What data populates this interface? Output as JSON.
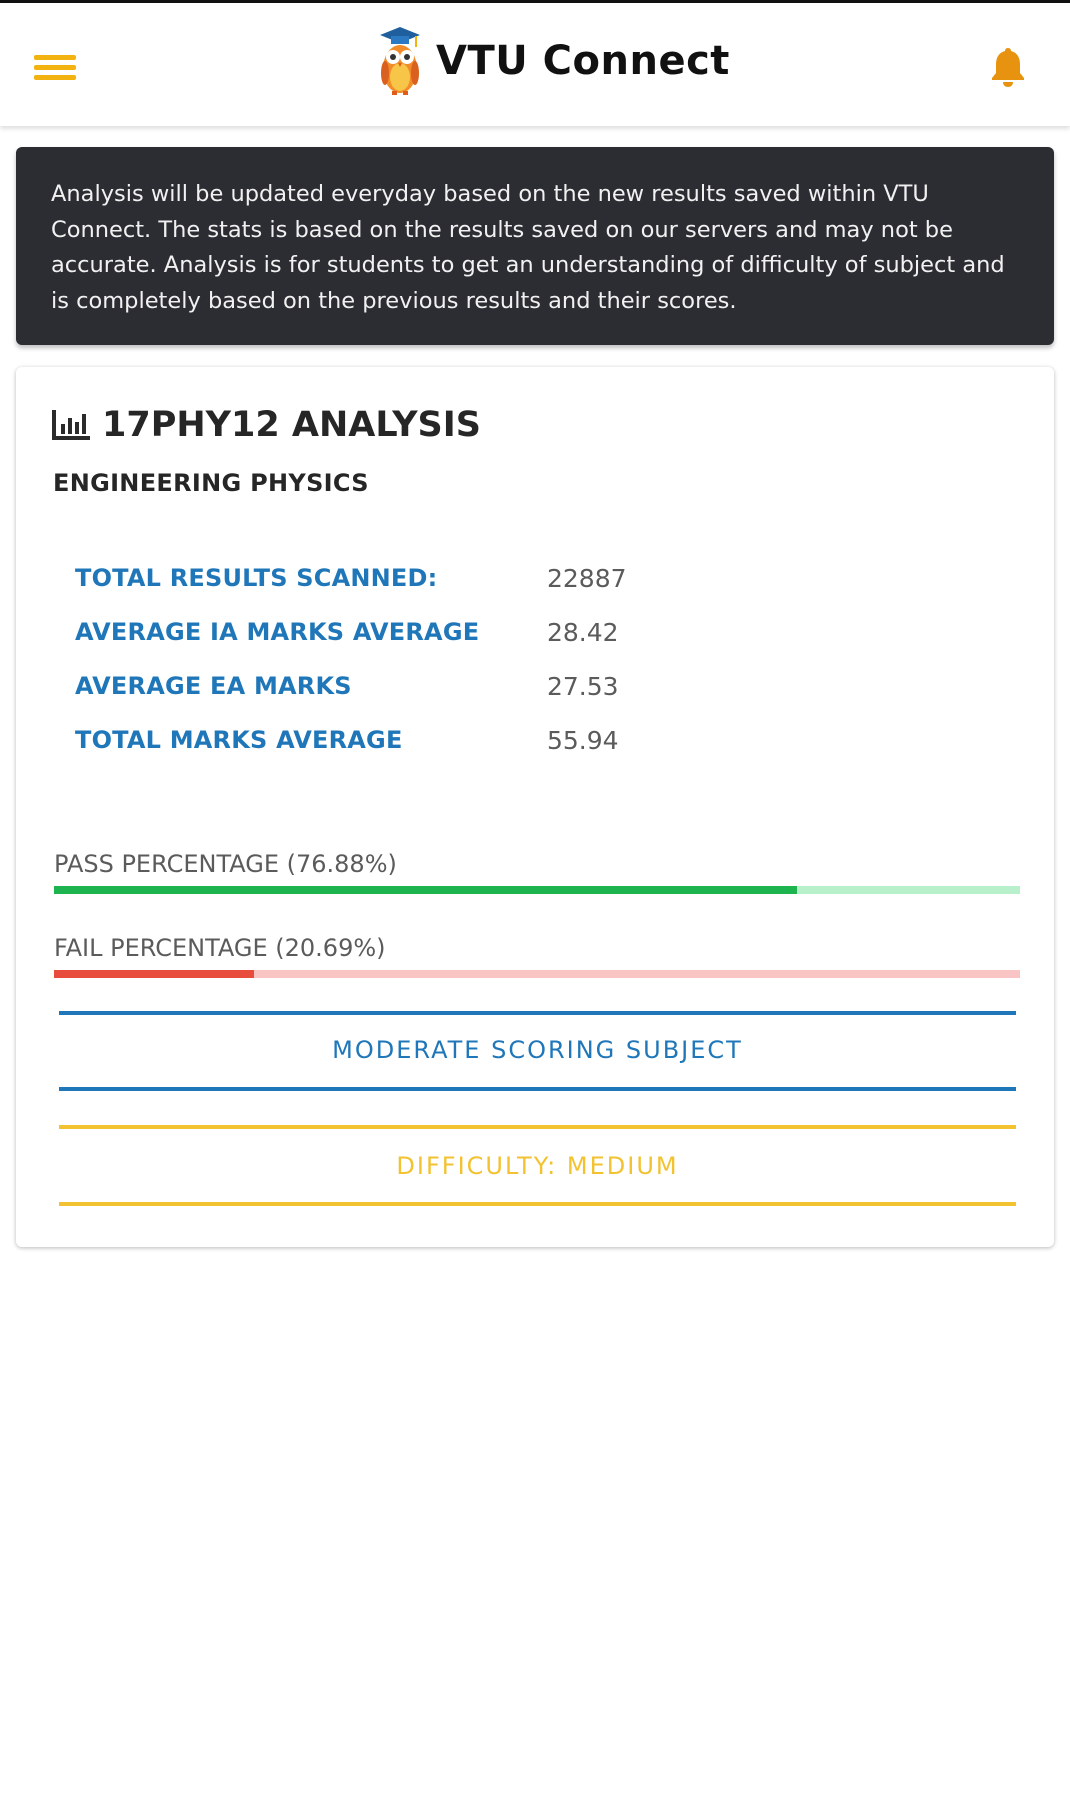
{
  "app": {
    "title": "VTU Connect",
    "menu_icon": "hamburger-menu-icon",
    "notification_icon": "bell-icon",
    "accent_color": "#f2b311"
  },
  "notice": {
    "text": "Analysis will be updated everyday based on the new results saved within VTU Connect. The stats is based on the results saved on our servers and may not be accurate. Analysis is for students to get an understanding of difficulty of subject and is completely based on the previous results and their scores."
  },
  "analysis": {
    "title": "17PHY12 ANALYSIS",
    "title_icon": "bar-chart-icon",
    "subject": "ENGINEERING PHYSICS",
    "stats": [
      {
        "label": "TOTAL RESULTS SCANNED:",
        "value": "22887"
      },
      {
        "label": "AVERAGE IA MARKS AVERAGE",
        "value": "28.42"
      },
      {
        "label": "AVERAGE EA MARKS",
        "value": "27.53"
      },
      {
        "label": "TOTAL MARKS AVERAGE",
        "value": "55.94"
      }
    ],
    "pass": {
      "label": "PASS PERCENTAGE (76.88%)",
      "percent": 76.88,
      "color": "#1db34f",
      "track_color": "#b8f0cb"
    },
    "fail": {
      "label": "FAIL PERCENTAGE (20.69%)",
      "percent": 20.69,
      "color": "#e74c3c",
      "track_color": "#f8c4c4"
    },
    "scoring": {
      "text": "MODERATE SCORING SUBJECT",
      "color": "#1f77b9"
    },
    "difficulty": {
      "text": "DIFFICULTY: MEDIUM",
      "color": "#f2c230"
    }
  }
}
